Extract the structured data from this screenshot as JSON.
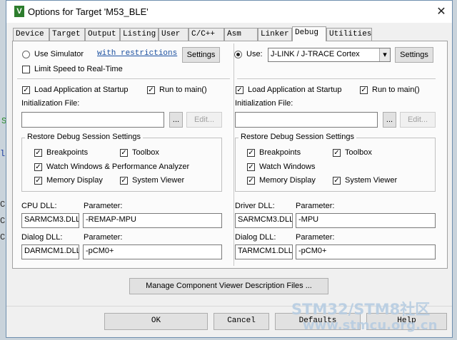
{
  "background": {
    "snippets": [
      "S",
      "l",
      "C",
      "C",
      "C"
    ]
  },
  "window": {
    "title": "Options for Target 'M53_BLE'",
    "icon": "V",
    "close": "✕"
  },
  "tabs": [
    "Device",
    "Target",
    "Output",
    "Listing",
    "User",
    "C/C++",
    "Asm",
    "Linker",
    "Debug",
    "Utilities"
  ],
  "left": {
    "use_simulator": "Use Simulator",
    "restrictions_link": "with restrictions",
    "settings": "Settings",
    "limit_speed": "Limit Speed to Real-Time",
    "load_app": "Load Application at Startup",
    "run_to_main": "Run to main()",
    "init_file_label": "Initialization File:",
    "init_file_value": "",
    "browse": "...",
    "edit": "Edit...",
    "restore_title": "Restore Debug Session Settings",
    "breakpoints": "Breakpoints",
    "toolbox": "Toolbox",
    "watch": "Watch Windows & Performance Analyzer",
    "memory": "Memory Display",
    "viewer": "System Viewer",
    "cpu_dll_label": "CPU DLL:",
    "cpu_dll": "SARMCM3.DLL",
    "cpu_param_label": "Parameter:",
    "cpu_param": "-REMAP-MPU",
    "dialog_dll_label": "Dialog DLL:",
    "dialog_dll": "DARMCM1.DLL",
    "dialog_param_label": "Parameter:",
    "dialog_param": "-pCM0+"
  },
  "right": {
    "use": "Use:",
    "driver": "J-LINK / J-TRACE Cortex",
    "settings": "Settings",
    "load_app": "Load Application at Startup",
    "run_to_main": "Run to main()",
    "init_file_label": "Initialization File:",
    "init_file_value": "",
    "browse": "...",
    "edit": "Edit...",
    "restore_title": "Restore Debug Session Settings",
    "breakpoints": "Breakpoints",
    "toolbox": "Toolbox",
    "watch": "Watch Windows",
    "memory": "Memory Display",
    "viewer": "System Viewer",
    "driver_dll_label": "Driver DLL:",
    "driver_dll": "SARMCM3.DLL",
    "driver_param_label": "Parameter:",
    "driver_param": "-MPU",
    "dialog_dll_label": "Dialog DLL:",
    "dialog_dll": "TARMCM1.DLL",
    "dialog_param_label": "Parameter:",
    "dialog_param": "-pCM0+"
  },
  "manage_button": "Manage Component Viewer Description Files ...",
  "footer": {
    "ok": "OK",
    "cancel": "Cancel",
    "defaults": "Defaults",
    "help": "Help"
  },
  "watermark": {
    "line1": "STM32/STM8社区",
    "line2": "www.stmcu.org.cn"
  },
  "check": "✓",
  "arrow": "▾"
}
